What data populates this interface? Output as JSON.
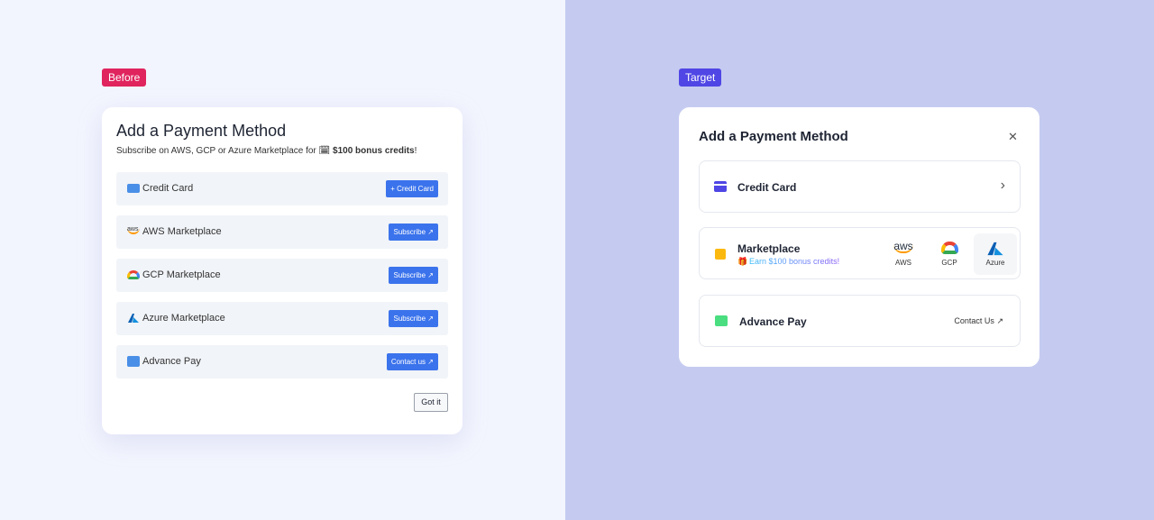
{
  "before": {
    "badge": "Before",
    "badge_color": "#e0245e",
    "title": "Add a Payment Method",
    "subtitle_prefix": "Subscribe on AWS, GCP or Azure Marketplace for",
    "subtitle_bonus": "$100 bonus credits",
    "subtitle_suffix": "!",
    "rows": [
      {
        "label": "Credit Card",
        "button": "+ Credit Card",
        "icon": "credit-card-icon"
      },
      {
        "label": "AWS Marketplace",
        "button": "Subscribe",
        "icon": "aws-icon"
      },
      {
        "label": "GCP Marketplace",
        "button": "Subscribe",
        "icon": "gcp-icon"
      },
      {
        "label": "Azure Marketplace",
        "button": "Subscribe",
        "icon": "azure-icon"
      },
      {
        "label": "Advance Pay",
        "button": "Contact us",
        "icon": "wallet-icon"
      }
    ],
    "got_it": "Got it"
  },
  "target": {
    "badge": "Target",
    "badge_color": "#4f46e5",
    "title": "Add a Payment Method",
    "credit_card": "Credit Card",
    "marketplace": "Marketplace",
    "earn": "Earn $100 bonus credits!",
    "providers": [
      {
        "name": "AWS"
      },
      {
        "name": "GCP"
      },
      {
        "name": "Azure",
        "selected": true
      }
    ],
    "advance_pay": "Advance Pay",
    "contact": "Contact Us"
  }
}
